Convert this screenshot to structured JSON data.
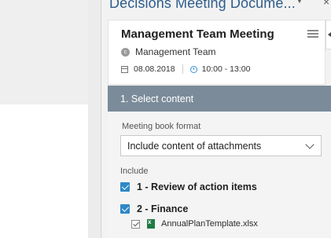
{
  "pane": {
    "title": "Decisions Meeting Docume...",
    "menu_icon": "caret-down-icon",
    "close_label": "×"
  },
  "meeting": {
    "title": "Management Team Meeting",
    "team_initial": "c",
    "team": "Management Team",
    "date": "08.08.2018",
    "time": "10:00 - 13:00"
  },
  "section": {
    "header": "1. Select content",
    "format_label": "Meeting book format",
    "format_value": "Include content of attachments",
    "include_label": "Include",
    "items": [
      {
        "label": "1 - Review of action items",
        "checked": true
      },
      {
        "label": "2 - Finance",
        "checked": true
      }
    ],
    "attachments": [
      {
        "label": "AnnualPlanTemplate.xlsx",
        "checked": true,
        "icon": "excel-file-icon"
      }
    ]
  },
  "colors": {
    "section_header_bg": "#7b8b99",
    "checkbox": "#2e88c9",
    "title": "#2f5d8c"
  }
}
